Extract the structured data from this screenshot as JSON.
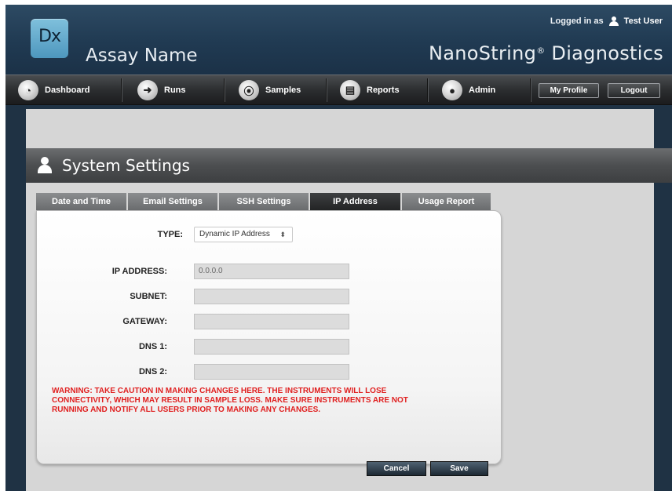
{
  "header": {
    "logo_text": "Dx",
    "assay_name": "Assay Name",
    "brand": "NanoString",
    "brand_mark": "®",
    "brand_suffix": " Diagnostics",
    "login_prefix": "Logged in as",
    "username": "Test User"
  },
  "nav": {
    "items": [
      {
        "label": "Dashboard",
        "icon": "dashboard-icon"
      },
      {
        "label": "Runs",
        "icon": "arrow-right-icon"
      },
      {
        "label": "Samples",
        "icon": "samples-icon"
      },
      {
        "label": "Reports",
        "icon": "reports-icon"
      },
      {
        "label": "Admin",
        "icon": "admin-icon"
      }
    ],
    "my_profile": "My Profile",
    "logout": "Logout"
  },
  "page": {
    "title": "System Settings"
  },
  "tabs": [
    {
      "label": "Date and Time",
      "active": false
    },
    {
      "label": "Email Settings",
      "active": false
    },
    {
      "label": "SSH Settings",
      "active": false
    },
    {
      "label": "IP Address",
      "active": true
    },
    {
      "label": "Usage Report",
      "active": false
    }
  ],
  "form": {
    "type_label": "TYPE:",
    "type_value": "Dynamic IP Address",
    "ip_label": "IP ADDRESS:",
    "ip_value": "0.0.0.0",
    "subnet_label": "SUBNET:",
    "subnet_value": "",
    "gateway_label": "GATEWAY:",
    "gateway_value": "",
    "dns1_label": "DNS 1:",
    "dns1_value": "",
    "dns2_label": "DNS 2:",
    "dns2_value": ""
  },
  "warning": "WARNING: TAKE CAUTION IN MAKING CHANGES HERE. THE INSTRUMENTS WILL LOSE CONNECTIVITY, WHICH MAY RESULT IN SAMPLE LOSS. MAKE SURE INSTRUMENTS ARE NOT RUNNING AND NOTIFY ALL USERS PRIOR TO MAKING ANY CHANGES.",
  "actions": {
    "cancel": "Cancel",
    "save": "Save"
  },
  "colors": {
    "header_bg": "#203a52",
    "warning": "#e02020",
    "active_tab": "#232425"
  }
}
